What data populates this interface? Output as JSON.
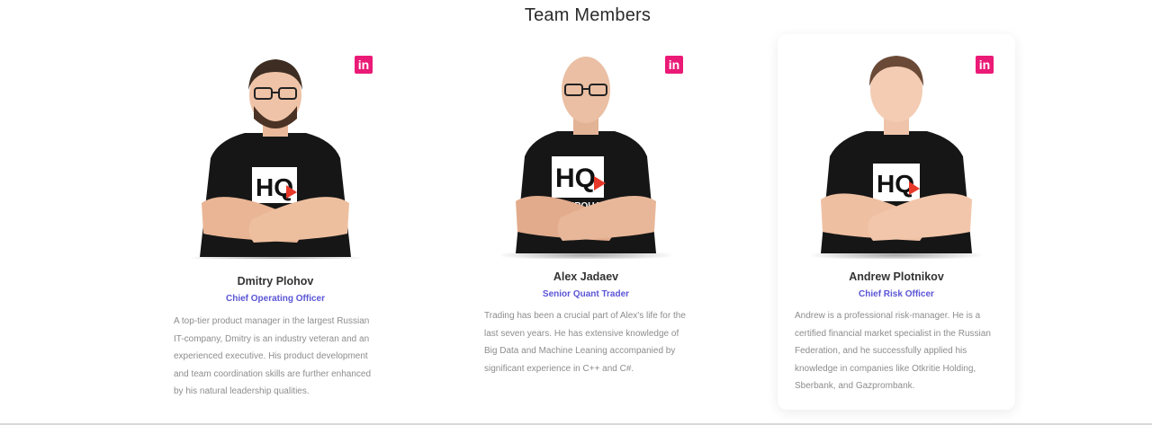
{
  "section": {
    "title": "Team Members"
  },
  "linkedin_icon": "linkedin-icon",
  "members": [
    {
      "name": "Dmitry Plohov",
      "role": "Chief Operating Officer",
      "bio": "A top-tier product manager in the largest Russian IT-company, Dmitry is an industry veteran and an experienced executive. His product development and team coordination skills are further enhanced by his natural leadership qualities."
    },
    {
      "name": "Alex Jadaev",
      "role": "Senior Quant Trader",
      "bio": "Trading has been a crucial part of Alex's life for the last seven years. He has extensive knowledge of Big Data and Machine Leaning accompanied by significant experience in C++ and C#."
    },
    {
      "name": "Andrew Plotnikov",
      "role": "Chief Risk Officer",
      "bio": "Andrew is a professional risk-manager. He is a certified financial market specialist in the Russian Federation, and he successfully applied his knowledge in companies like Otkritie Holding, Sberbank, and Gazprombank."
    }
  ],
  "colors": {
    "accent": "#5b55d6",
    "linkedin": "#ea1a76"
  }
}
